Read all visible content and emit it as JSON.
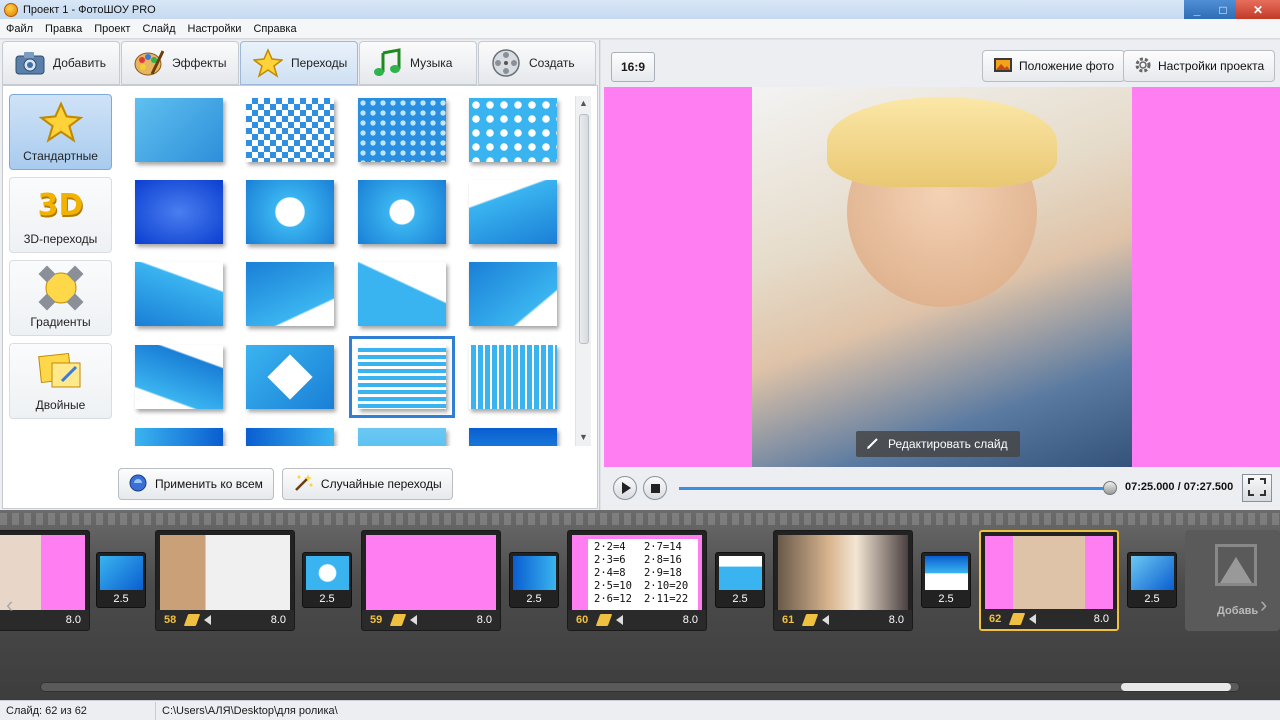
{
  "window": {
    "title": "Проект 1 - ФотоШОУ PRO",
    "controls": [
      "_",
      "□",
      "✕"
    ]
  },
  "menu": [
    "Файл",
    "Правка",
    "Проект",
    "Слайд",
    "Настройки",
    "Справка"
  ],
  "tabs": [
    {
      "label": "Добавить",
      "icon": "camera-icon"
    },
    {
      "label": "Эффекты",
      "icon": "palette-icon"
    },
    {
      "label": "Переходы",
      "icon": "star-icon",
      "active": true
    },
    {
      "label": "Музыка",
      "icon": "music-note-icon"
    },
    {
      "label": "Создать",
      "icon": "film-reel-icon"
    }
  ],
  "categories": [
    {
      "label": "Стандартные",
      "icon": "star-icon",
      "active": true
    },
    {
      "label": "3D-переходы",
      "icon": "3d-icon"
    },
    {
      "label": "Градиенты",
      "icon": "gradient-icon"
    },
    {
      "label": "Двойные",
      "icon": "double-icon"
    }
  ],
  "category_3d_text": "3D",
  "buttons": {
    "apply_all": "Применить ко всем",
    "random": "Случайные переходы"
  },
  "preview": {
    "ratio": "16:9",
    "photo_position": "Положение фото",
    "project_settings": "Настройки проекта",
    "edit_slide": "Редактировать слайд",
    "colors": {
      "background": "#ff7ff2"
    }
  },
  "player": {
    "time": "07:25.000 / 07:27.500",
    "progress": 0.997
  },
  "timeline": {
    "slides": [
      {
        "number": "",
        "duration": "8.0"
      },
      {
        "number": "58",
        "duration": "8.0"
      },
      {
        "number": "59",
        "duration": "8.0"
      },
      {
        "number": "60",
        "duration": "8.0"
      },
      {
        "number": "61",
        "duration": "8.0"
      },
      {
        "number": "62",
        "duration": "8.0"
      }
    ],
    "transitions": [
      "2.5",
      "2.5",
      "2.5",
      "2.5",
      "2.5",
      "2.5"
    ],
    "add_label": "Добавь"
  },
  "mult_table": {
    "left": [
      "2·2=4",
      "2·3=6",
      "2·4=8",
      "2·5=10",
      "2·6=12"
    ],
    "right": [
      "2·7=14",
      "2·8=16",
      "2·9=18",
      "2·10=20",
      "2·11=22"
    ]
  },
  "status": {
    "slide": "Слайд: 62 из 62",
    "path": "C:\\Users\\АЛЯ\\Desktop\\для ролика\\"
  }
}
